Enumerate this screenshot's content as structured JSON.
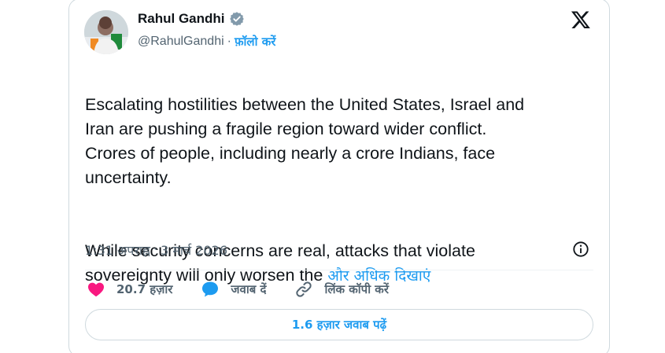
{
  "author": {
    "name": "Rahul Gandhi",
    "handle": "@RahulGandhi",
    "separator": "·",
    "follow_label": "फ़ॉलो करें"
  },
  "tweet": {
    "paragraph1": "Escalating hostilities between the United States, Israel and\nIran are pushing a fragile region toward wider conflict.\nCrores of people, including nearly a crore Indians, face\nuncertainty.",
    "paragraph2": "While security concerns are real, attacks that violate\nsovereignty will only worsen the ",
    "show_more": "और अधिक दिखाएं"
  },
  "meta": {
    "time": "1:31 अपराह्न",
    "separator": "·",
    "date": "3 मार्च 2026"
  },
  "actions": {
    "like_count": "20.7 हज़ार",
    "reply_label": "जवाब दें",
    "copy_link_label": "लिंक कॉपी करें"
  },
  "read_replies_label": "1.6 हज़ार जवाब पढ़ें",
  "icons": {
    "verified": "verified-badge-icon",
    "logo": "x-logo-icon",
    "info": "info-icon",
    "like": "heart-icon",
    "reply": "speech-bubble-icon",
    "link": "link-icon"
  },
  "colors": {
    "accent": "#1d9bf0",
    "like": "#f91880",
    "text": "#0f1419",
    "muted": "#536471",
    "border": "#cfd9de"
  }
}
